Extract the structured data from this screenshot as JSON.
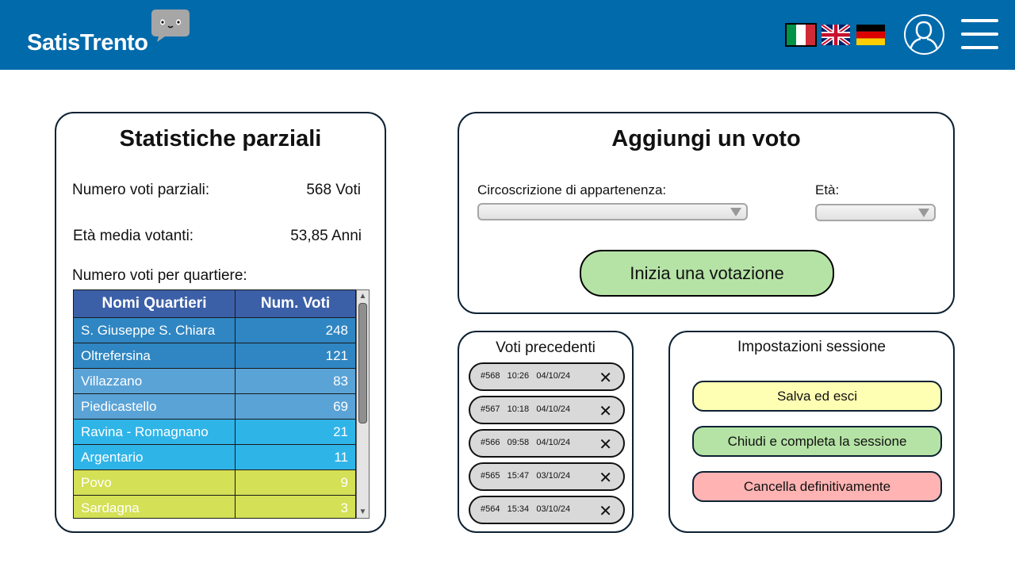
{
  "app": {
    "name": "SatisTrento"
  },
  "header": {
    "languages": [
      {
        "code": "it",
        "icon": "italy-flag-icon"
      },
      {
        "code": "en",
        "icon": "uk-flag-icon"
      },
      {
        "code": "de",
        "icon": "germany-flag-icon"
      }
    ],
    "user_icon": "user-icon",
    "menu_icon": "hamburger-menu-icon",
    "bar_color": "#006aab"
  },
  "stats": {
    "title": "Statistiche parziali",
    "partial_votes_label": "Numero voti parziali:",
    "partial_votes_value": "568 Voti",
    "avg_age_label": "Età media votanti:",
    "avg_age_value": "53,85 Anni",
    "per_district_label": "Numero voti per quartiere:",
    "table": {
      "headers": [
        "Nomi Quartieri",
        "Num. Voti"
      ],
      "rows": [
        {
          "name": "S. Giuseppe S. Chiara",
          "votes": "248",
          "color": "#2f86c2"
        },
        {
          "name": "Oltrefersina",
          "votes": "121",
          "color": "#2f86c2"
        },
        {
          "name": "Villazzano",
          "votes": "83",
          "color": "#5aa3d7"
        },
        {
          "name": "Piedicastello",
          "votes": "69",
          "color": "#5aa3d7"
        },
        {
          "name": "Ravina - Romagnano",
          "votes": "21",
          "color": "#2fb4e8"
        },
        {
          "name": "Argentario",
          "votes": "11",
          "color": "#2fb4e8"
        },
        {
          "name": "Povo",
          "votes": "9",
          "color": "#d4e055"
        },
        {
          "name": "Sardagna",
          "votes": "3",
          "color": "#d4e055"
        }
      ]
    }
  },
  "add_vote": {
    "title": "Aggiungi un voto",
    "district_label": "Circoscrizione di appartenenza:",
    "district_value": "",
    "age_label": "Età:",
    "age_value": "",
    "start_button": "Inizia una votazione",
    "start_button_color": "#b5e3a5"
  },
  "previous_votes": {
    "title": "Voti precedenti",
    "items": [
      {
        "id": "#568",
        "time": "10:26",
        "date": "04/10/24"
      },
      {
        "id": "#567",
        "time": "10:18",
        "date": "04/10/24"
      },
      {
        "id": "#566",
        "time": "09:58",
        "date": "04/10/24"
      },
      {
        "id": "#565",
        "time": "15:47",
        "date": "03/10/24"
      },
      {
        "id": "#564",
        "time": "15:34",
        "date": "03/10/24"
      }
    ],
    "delete_icon": "close-icon"
  },
  "session": {
    "title": "Impostazioni sessione",
    "save_exit": "Salva ed esci",
    "close_complete": "Chiudi e completa la sessione",
    "delete_forever": "Cancella definitivamente",
    "colors": {
      "save_exit": "#ffffb3",
      "close_complete": "#b5e3a5",
      "delete_forever": "#ffb3b3"
    }
  }
}
